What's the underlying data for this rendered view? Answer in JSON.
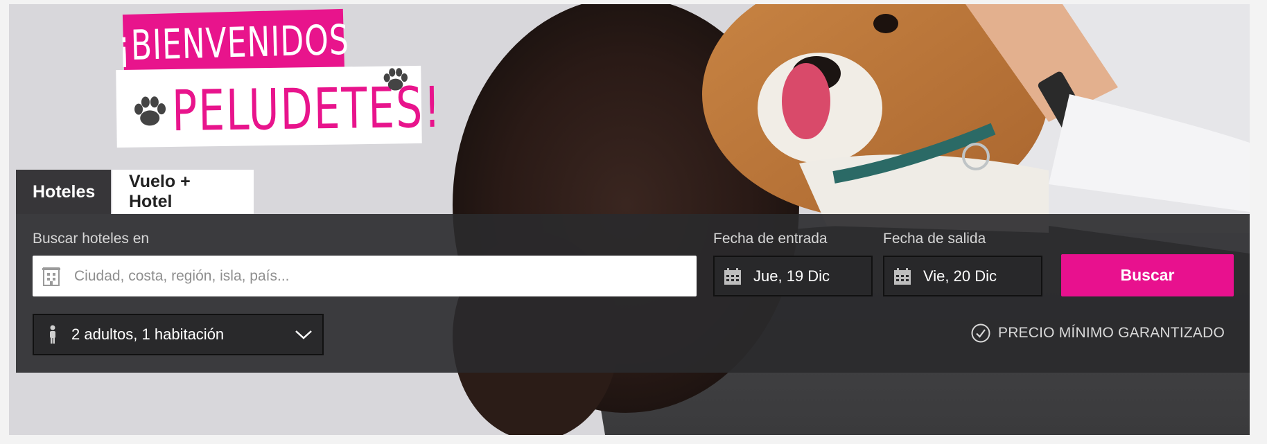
{
  "promo": {
    "line1": "¡BIENVENIDOS",
    "line2": "PELUDETES!"
  },
  "tabs": [
    {
      "label": "Hoteles",
      "active": true
    },
    {
      "label": "Vuelo + Hotel",
      "active": false
    }
  ],
  "search": {
    "destination_label": "Buscar hoteles en",
    "destination_placeholder": "Ciudad, costa, región, isla, país...",
    "destination_value": "",
    "destination_icon": "hotel-building-icon",
    "checkin_label": "Fecha de entrada",
    "checkin_value": "Jue, 19 Dic",
    "checkout_label": "Fecha de salida",
    "checkout_value": "Vie, 20 Dic",
    "date_icon": "calendar-icon",
    "button_label": "Buscar",
    "guests_value": "2 adultos, 1 habitación",
    "guests_icon": "person-icon",
    "guests_dropdown_icon": "chevron-down-icon",
    "guarantee_text": "PRECIO MÍNIMO GARANTIZADO",
    "guarantee_icon": "check-circle-icon"
  },
  "colors": {
    "accent": "#e8118e",
    "panel": "#2a2a2c",
    "text_light": "#d6d6d6"
  }
}
